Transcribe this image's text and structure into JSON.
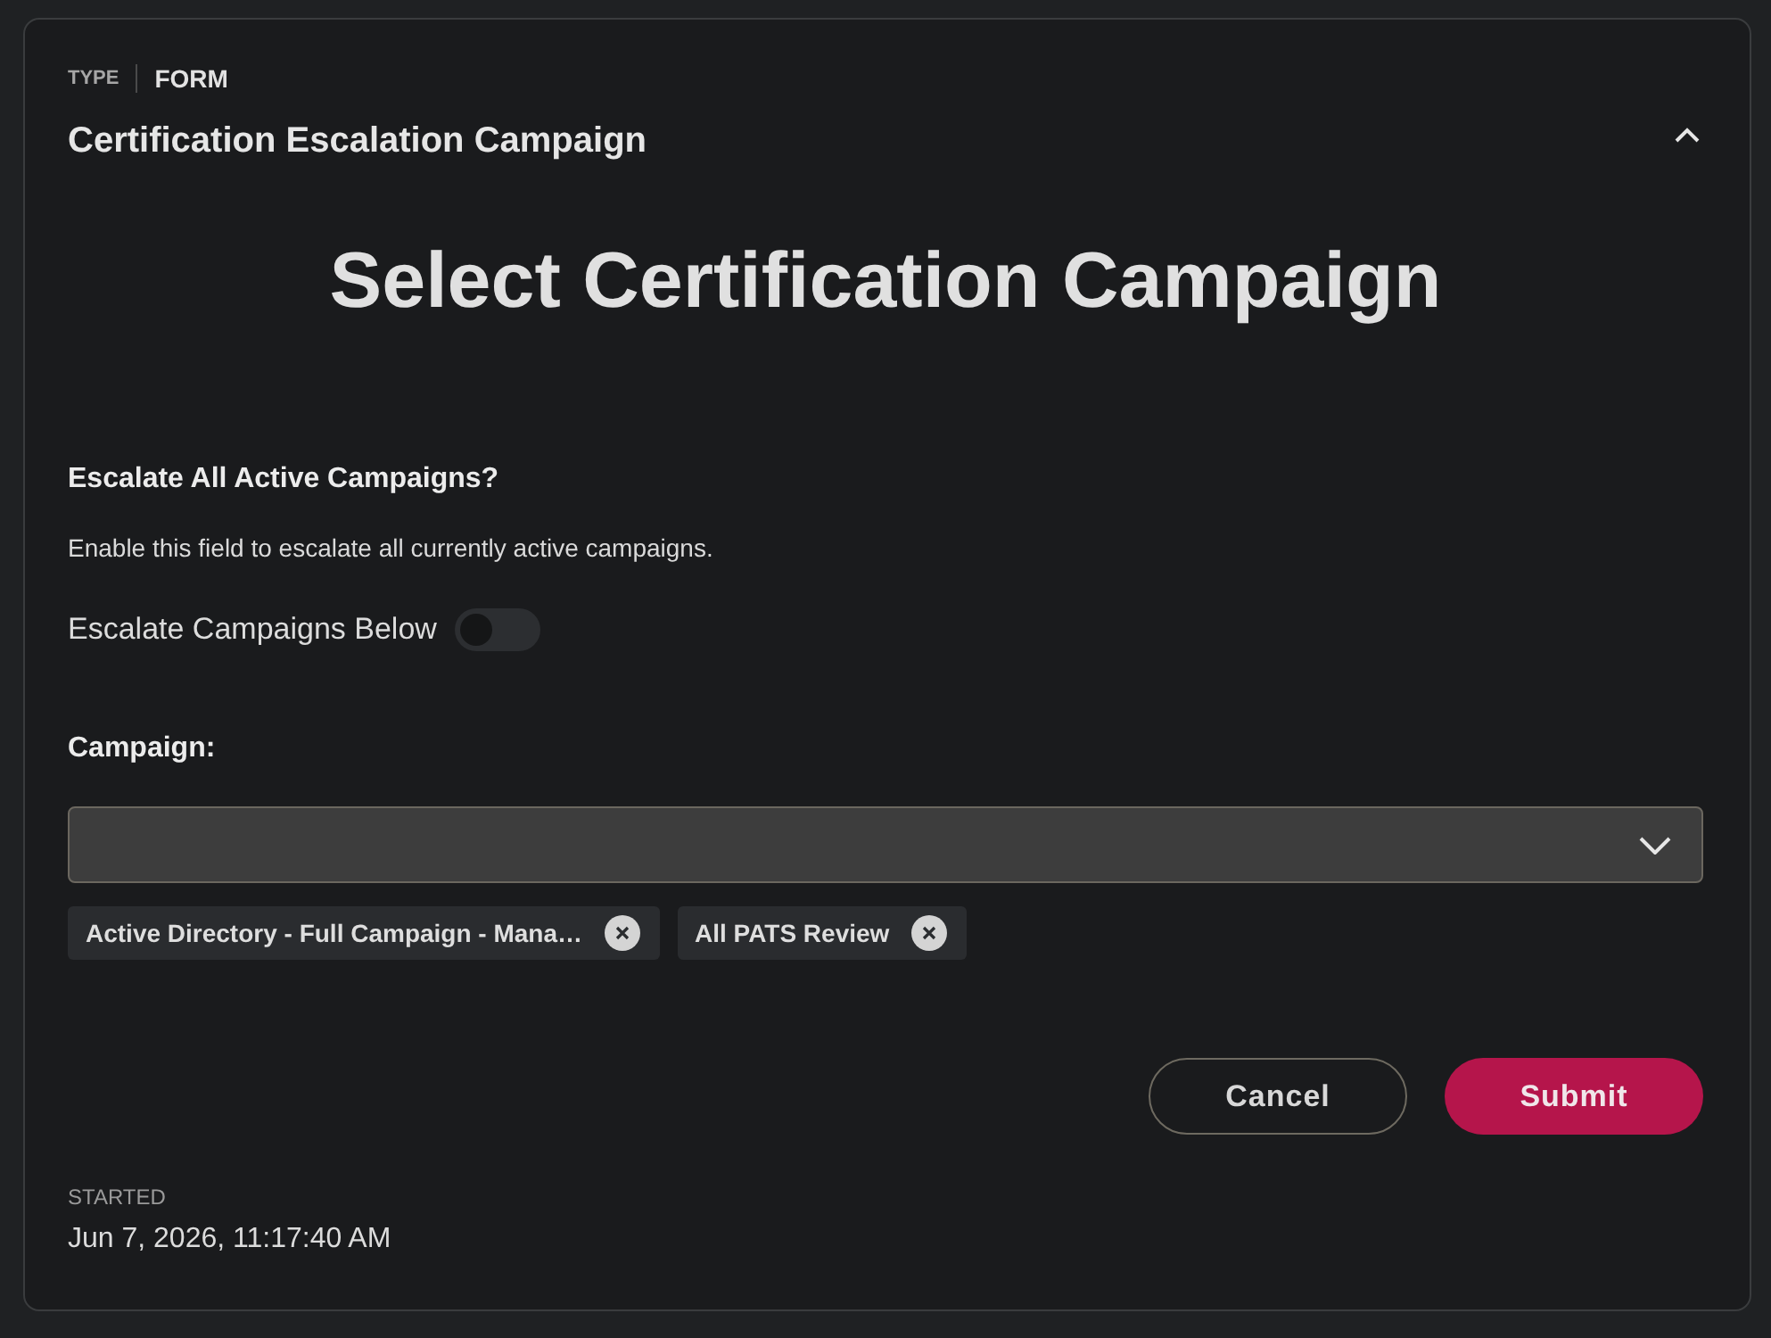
{
  "card": {
    "type_label": "TYPE",
    "type_value": "FORM",
    "title": "Certification Escalation Campaign",
    "expanded": true
  },
  "form": {
    "heading": "Select Certification Campaign",
    "escalate_all": {
      "label": "Escalate All Active Campaigns?",
      "description": "Enable this field to escalate all currently active campaigns.",
      "toggle_label": "Escalate Campaigns Below",
      "on": false
    },
    "campaign": {
      "label": "Campaign:",
      "selected_tags": [
        {
          "label": "Active Directory - Full Campaign - Mana…"
        },
        {
          "label": "All PATS Review"
        }
      ]
    },
    "buttons": [
      {
        "label": "Cancel",
        "kind": "secondary"
      },
      {
        "label": "Submit",
        "kind": "primary"
      }
    ]
  },
  "started": {
    "label": "STARTED",
    "value": "Jun 7, 2026, 11:17:40 AM"
  }
}
